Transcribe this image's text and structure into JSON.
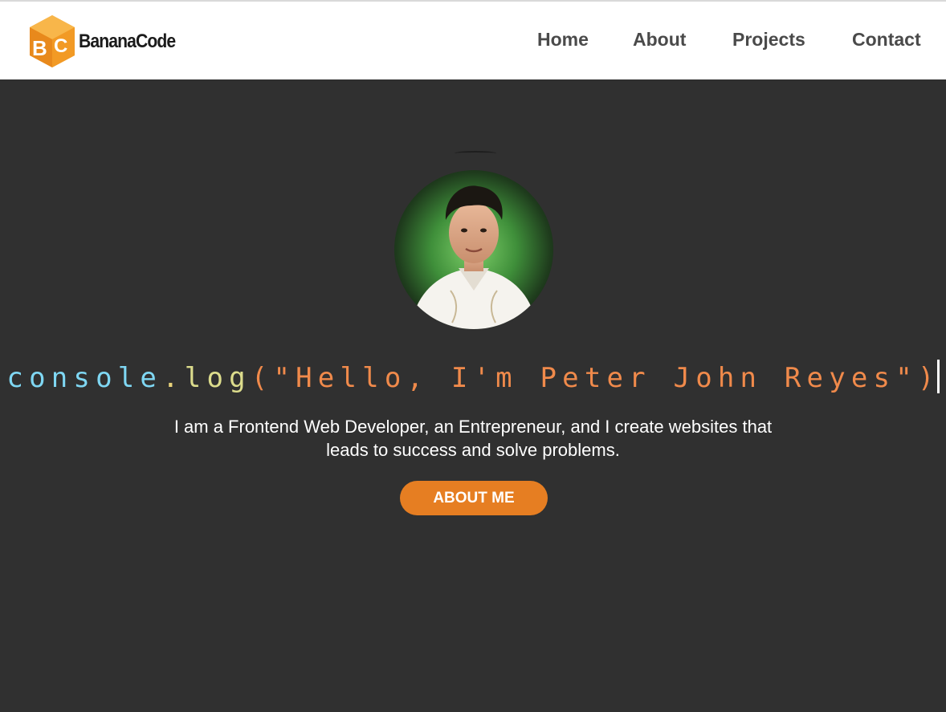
{
  "nav": {
    "logo_text": "BananaCode",
    "links": [
      {
        "label": "Home"
      },
      {
        "label": "About"
      },
      {
        "label": "Projects"
      },
      {
        "label": "Contact"
      }
    ]
  },
  "hero": {
    "headline": {
      "console": "console",
      "dot": ".",
      "log": "log",
      "open_paren": "(",
      "string": "\"Hello, I'm Peter John Reyes\"",
      "close_paren": ")"
    },
    "intro_line1": "I am a Frontend Web Developer, an Entrepreneur, and I create websites that",
    "intro_line2": "leads to success and solve problems.",
    "button_label": "ABOUT ME"
  },
  "colors": {
    "accent": "#e67e22",
    "background": "#303030",
    "navbar": "#ffffff",
    "code_keyword": "#7fd7f3",
    "code_function": "#dcdc8c",
    "code_string": "#f08a4b"
  },
  "icons": {
    "logo": "banana-code-logo-icon",
    "avatar": "profile-photo"
  }
}
